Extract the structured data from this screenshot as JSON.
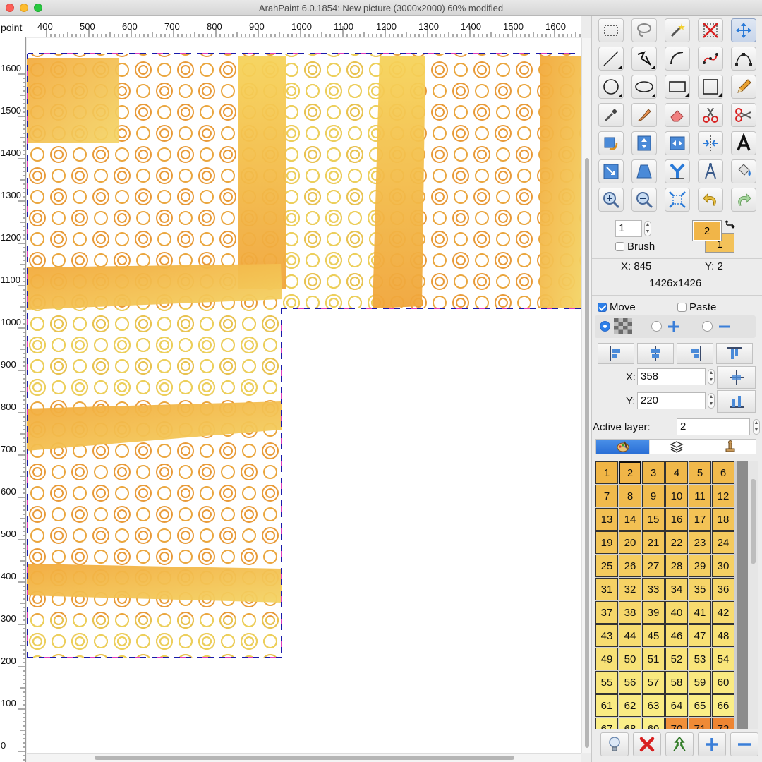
{
  "window": {
    "title": "ArahPaint 6.0.1854: New picture  (3000x2000) 60% modified"
  },
  "rulers": {
    "unit": "point",
    "horizontal_labels": [
      "400",
      "500",
      "600",
      "700",
      "800",
      "900",
      "1000",
      "1100",
      "1200",
      "1300",
      "1400",
      "1500",
      "1600"
    ],
    "vertical_labels": [
      "1600",
      "1500",
      "1400",
      "1300",
      "1200",
      "1100",
      "1000",
      "900",
      "800",
      "700",
      "600",
      "500",
      "400",
      "300",
      "200",
      "100",
      "0"
    ]
  },
  "tools": [
    {
      "name": "rectangle-select",
      "icon": "rect-select-icon"
    },
    {
      "name": "lasso-select",
      "icon": "lasso-icon"
    },
    {
      "name": "magic-wand",
      "icon": "magic-wand-icon"
    },
    {
      "name": "deselect",
      "icon": "deselect-icon"
    },
    {
      "name": "move",
      "icon": "move-arrows-icon",
      "active": true
    },
    {
      "name": "line",
      "icon": "line-icon"
    },
    {
      "name": "polyline",
      "icon": "polyline-icon"
    },
    {
      "name": "curve",
      "icon": "curve-icon"
    },
    {
      "name": "bezier-points",
      "icon": "bezier-points-icon"
    },
    {
      "name": "bezier",
      "icon": "bezier-icon"
    },
    {
      "name": "circle",
      "icon": "circle-icon"
    },
    {
      "name": "ellipse",
      "icon": "ellipse-icon"
    },
    {
      "name": "rectangle",
      "icon": "rectangle-icon"
    },
    {
      "name": "square",
      "icon": "square-icon"
    },
    {
      "name": "pencil",
      "icon": "pencil-icon"
    },
    {
      "name": "eyedropper",
      "icon": "eyedropper-icon"
    },
    {
      "name": "brush-fill",
      "icon": "brush-icon"
    },
    {
      "name": "eraser",
      "icon": "eraser-icon"
    },
    {
      "name": "scissors-cut",
      "icon": "scissors-icon"
    },
    {
      "name": "scissors-red",
      "icon": "scissors-red-icon"
    },
    {
      "name": "rotate-fill",
      "icon": "rotate-bucket-icon"
    },
    {
      "name": "flip-vertical",
      "icon": "flip-vertical-icon"
    },
    {
      "name": "flip-horizontal",
      "icon": "flip-horizontal-icon"
    },
    {
      "name": "mirror",
      "icon": "mirror-icon"
    },
    {
      "name": "text",
      "icon": "text-a-icon"
    },
    {
      "name": "resize",
      "icon": "resize-icon"
    },
    {
      "name": "perspective",
      "icon": "perspective-icon"
    },
    {
      "name": "y-split",
      "icon": "y-split-icon"
    },
    {
      "name": "compass",
      "icon": "compass-icon"
    },
    {
      "name": "fill-bucket",
      "icon": "fill-bucket-icon"
    },
    {
      "name": "zoom-in",
      "icon": "zoom-in-icon"
    },
    {
      "name": "zoom-out",
      "icon": "zoom-out-icon"
    },
    {
      "name": "fit-to-window",
      "icon": "fit-window-icon"
    },
    {
      "name": "undo",
      "icon": "undo-icon"
    },
    {
      "name": "redo",
      "icon": "redo-icon"
    }
  ],
  "brush": {
    "size": "1",
    "label": "Brush",
    "checked": false,
    "fg_color_index": "2",
    "bg_color_index": "1"
  },
  "status": {
    "x_label": "X: 845",
    "y_label": "Y: 2",
    "dimensions": "1426x1426"
  },
  "move_panel": {
    "move_label": "Move",
    "move_checked": true,
    "paste_label": "Paste",
    "paste_checked": false,
    "x_label": "X:",
    "x_value": "358",
    "y_label": "Y:",
    "y_value": "220"
  },
  "layer": {
    "label": "Active layer:",
    "value": "2"
  },
  "palette": {
    "columns": 6,
    "selected": 2,
    "cells": [
      {
        "n": "1",
        "c": "#f0b545"
      },
      {
        "n": "2",
        "c": "#f0b548"
      },
      {
        "n": "3",
        "c": "#f0b84a"
      },
      {
        "n": "4",
        "c": "#f0b84a"
      },
      {
        "n": "5",
        "c": "#f1b94b"
      },
      {
        "n": "6",
        "c": "#f1ba4c"
      },
      {
        "n": "7",
        "c": "#f1ba4c"
      },
      {
        "n": "8",
        "c": "#f1bb4d"
      },
      {
        "n": "9",
        "c": "#f1bc4e"
      },
      {
        "n": "10",
        "c": "#f1bc4f"
      },
      {
        "n": "11",
        "c": "#f2bd50"
      },
      {
        "n": "12",
        "c": "#f2be51"
      },
      {
        "n": "13",
        "c": "#f2bf52"
      },
      {
        "n": "14",
        "c": "#f2c053"
      },
      {
        "n": "15",
        "c": "#f2c154"
      },
      {
        "n": "16",
        "c": "#f3c255"
      },
      {
        "n": "17",
        "c": "#f3c356"
      },
      {
        "n": "18",
        "c": "#f3c457"
      },
      {
        "n": "19",
        "c": "#f3c558"
      },
      {
        "n": "20",
        "c": "#f3c659"
      },
      {
        "n": "21",
        "c": "#f4c75a"
      },
      {
        "n": "22",
        "c": "#f4c85b"
      },
      {
        "n": "23",
        "c": "#f4c95c"
      },
      {
        "n": "24",
        "c": "#f4ca5d"
      },
      {
        "n": "25",
        "c": "#f4cb5e"
      },
      {
        "n": "26",
        "c": "#f5cc5f"
      },
      {
        "n": "27",
        "c": "#f5cd60"
      },
      {
        "n": "28",
        "c": "#f5ce61"
      },
      {
        "n": "29",
        "c": "#f5cf62"
      },
      {
        "n": "30",
        "c": "#f5d063"
      },
      {
        "n": "31",
        "c": "#f5d164"
      },
      {
        "n": "32",
        "c": "#f6d265"
      },
      {
        "n": "33",
        "c": "#f6d366"
      },
      {
        "n": "34",
        "c": "#f6d467"
      },
      {
        "n": "35",
        "c": "#f6d568"
      },
      {
        "n": "36",
        "c": "#f6d669"
      },
      {
        "n": "37",
        "c": "#f6d76a"
      },
      {
        "n": "38",
        "c": "#f7d86b"
      },
      {
        "n": "39",
        "c": "#f7d96c"
      },
      {
        "n": "40",
        "c": "#f7da6d"
      },
      {
        "n": "41",
        "c": "#f7da6e"
      },
      {
        "n": "42",
        "c": "#f7db6f"
      },
      {
        "n": "43",
        "c": "#f7dc70"
      },
      {
        "n": "44",
        "c": "#f7dd71"
      },
      {
        "n": "45",
        "c": "#f8de72"
      },
      {
        "n": "46",
        "c": "#f8df73"
      },
      {
        "n": "47",
        "c": "#f8e074"
      },
      {
        "n": "48",
        "c": "#f8e175"
      },
      {
        "n": "49",
        "c": "#f8e176"
      },
      {
        "n": "50",
        "c": "#f8e277"
      },
      {
        "n": "51",
        "c": "#f8e378"
      },
      {
        "n": "52",
        "c": "#f9e479"
      },
      {
        "n": "53",
        "c": "#f9e57a"
      },
      {
        "n": "54",
        "c": "#f9e67b"
      },
      {
        "n": "55",
        "c": "#f9e67c"
      },
      {
        "n": "56",
        "c": "#f9e77d"
      },
      {
        "n": "57",
        "c": "#f9e87e"
      },
      {
        "n": "58",
        "c": "#f9e97f"
      },
      {
        "n": "59",
        "c": "#fae980"
      },
      {
        "n": "60",
        "c": "#faea81"
      },
      {
        "n": "61",
        "c": "#faeb82"
      },
      {
        "n": "62",
        "c": "#faeb83"
      },
      {
        "n": "63",
        "c": "#faec84"
      },
      {
        "n": "64",
        "c": "#faed85"
      },
      {
        "n": "65",
        "c": "#faee86"
      },
      {
        "n": "66",
        "c": "#faee87"
      },
      {
        "n": "67",
        "c": "#fbef88"
      },
      {
        "n": "68",
        "c": "#fbef89"
      },
      {
        "n": "69",
        "c": "#fbf08a"
      },
      {
        "n": "70",
        "c": "#f0903a"
      },
      {
        "n": "71",
        "c": "#ef8a36"
      },
      {
        "n": "72",
        "c": "#ee8532"
      }
    ]
  },
  "bottom_buttons": [
    {
      "name": "bulb",
      "icon": "lightbulb-icon"
    },
    {
      "name": "delete",
      "icon": "red-x-icon"
    },
    {
      "name": "merge",
      "icon": "merge-arrow-icon"
    },
    {
      "name": "add",
      "icon": "plus-icon"
    },
    {
      "name": "remove",
      "icon": "minus-icon"
    }
  ]
}
